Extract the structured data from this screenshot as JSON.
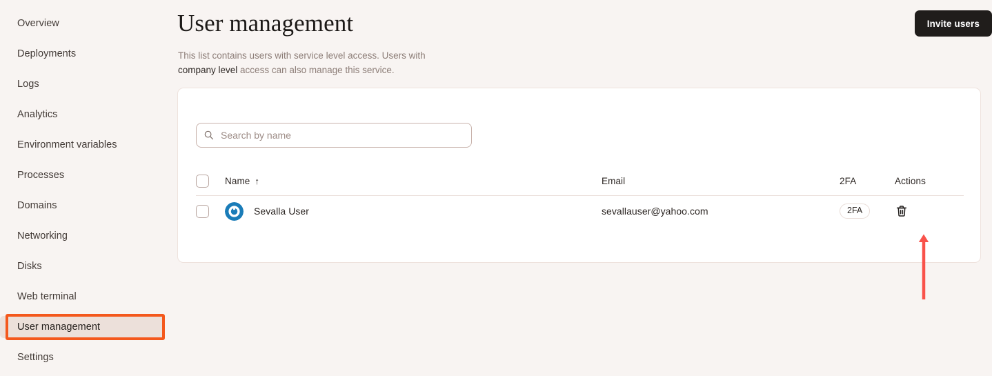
{
  "sidebar": {
    "items": [
      {
        "label": "Overview",
        "active": false
      },
      {
        "label": "Deployments",
        "active": false
      },
      {
        "label": "Logs",
        "active": false
      },
      {
        "label": "Analytics",
        "active": false
      },
      {
        "label": "Environment variables",
        "active": false
      },
      {
        "label": "Processes",
        "active": false
      },
      {
        "label": "Domains",
        "active": false
      },
      {
        "label": "Networking",
        "active": false
      },
      {
        "label": "Disks",
        "active": false
      },
      {
        "label": "Web terminal",
        "active": false
      },
      {
        "label": "User management",
        "active": true
      },
      {
        "label": "Settings",
        "active": false
      }
    ]
  },
  "header": {
    "title": "User management",
    "description_part1": "This list contains users with service level access. Users with ",
    "description_emphasis": "company level",
    "description_part2": " access can also manage this service.",
    "invite_label": "Invite users"
  },
  "search": {
    "placeholder": "Search by name",
    "value": "",
    "icon": "search-icon"
  },
  "table": {
    "columns": [
      {
        "key": "select",
        "label": ""
      },
      {
        "key": "name",
        "label": "Name",
        "sort": "ascending",
        "sort_glyph": "↑"
      },
      {
        "key": "email",
        "label": "Email"
      },
      {
        "key": "twofa",
        "label": "2FA"
      },
      {
        "key": "actions",
        "label": "Actions"
      }
    ],
    "rows": [
      {
        "selected": false,
        "avatar_icon": "gravatar-logo-icon",
        "avatar_color": "#1a7cb8",
        "name": "Sevalla User",
        "email": "sevallauser@yahoo.com",
        "twofa_badge": "2FA",
        "action_icon": "trash-icon"
      }
    ]
  },
  "annotations": {
    "nav_highlight_color": "#f4581c",
    "arrow_color": "#f9524a",
    "arrow_points_to": "trash-icon"
  },
  "colors": {
    "page_background": "#f8f4f2",
    "card_background": "#ffffff",
    "card_border": "#eee2dd",
    "active_nav_background": "#ece0da",
    "primary_button": "#201d1b",
    "text_primary": "#2b2522",
    "text_muted": "#8c7d77",
    "divider": "#eadfda"
  }
}
